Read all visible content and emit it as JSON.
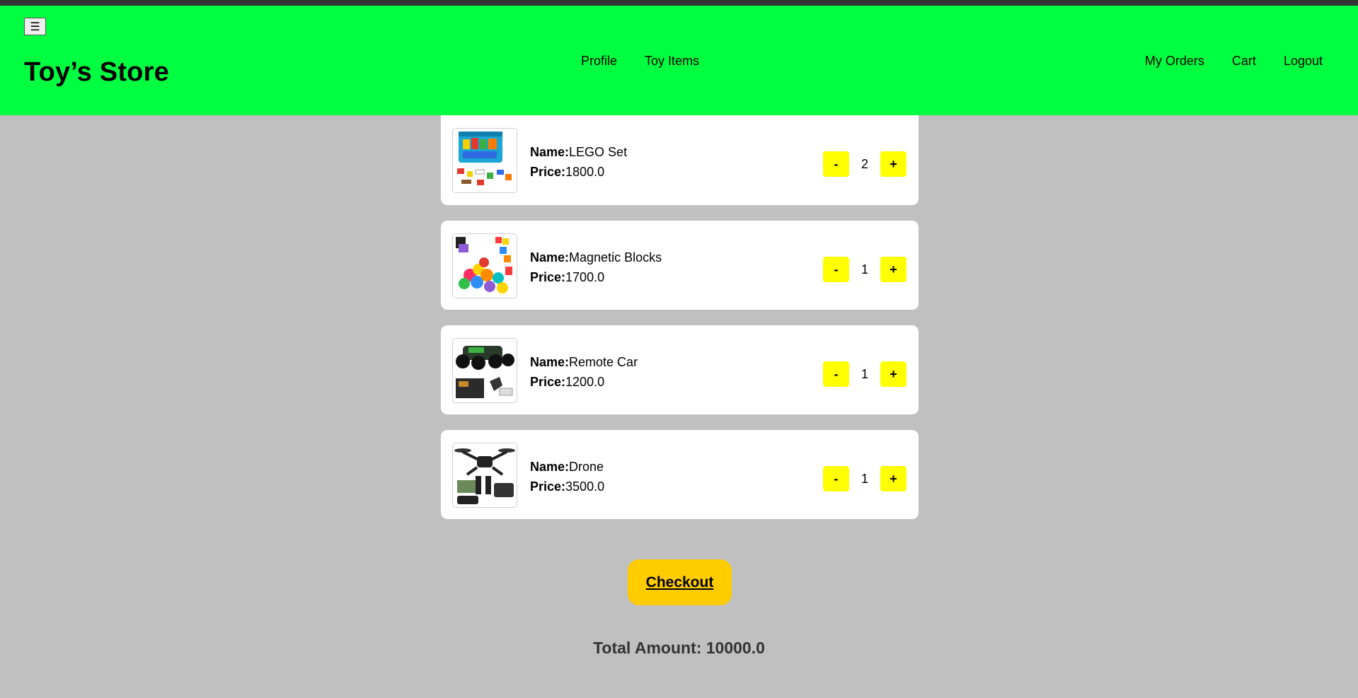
{
  "header": {
    "menu_icon": "☰",
    "brand": "Toy’s Store",
    "nav_center": [
      "Profile",
      "Toy Items"
    ],
    "nav_right": [
      "My Orders",
      "Cart",
      "Logout"
    ],
    "bg_color": "#00ff40"
  },
  "cart": {
    "name_label": "Name:",
    "price_label": "Price:",
    "minus_label": "-",
    "plus_label": "+",
    "items": [
      {
        "name": "LEGO Set",
        "price": "1800.0",
        "qty": "2",
        "image_icon": "lego-box-image"
      },
      {
        "name": "Magnetic Blocks",
        "price": "1700.0",
        "qty": "1",
        "image_icon": "magnetic-blocks-image"
      },
      {
        "name": "Remote Car",
        "price": "1200.0",
        "qty": "1",
        "image_icon": "remote-car-image"
      },
      {
        "name": "Drone",
        "price": "3500.0",
        "qty": "1",
        "image_icon": "drone-image"
      }
    ]
  },
  "checkout_label": "Checkout",
  "total_text": "Total Amount: 10000.0",
  "colors": {
    "page_bg": "#c0c0c0",
    "qty_button": "#ffff00",
    "checkout": "#ffcc00"
  }
}
